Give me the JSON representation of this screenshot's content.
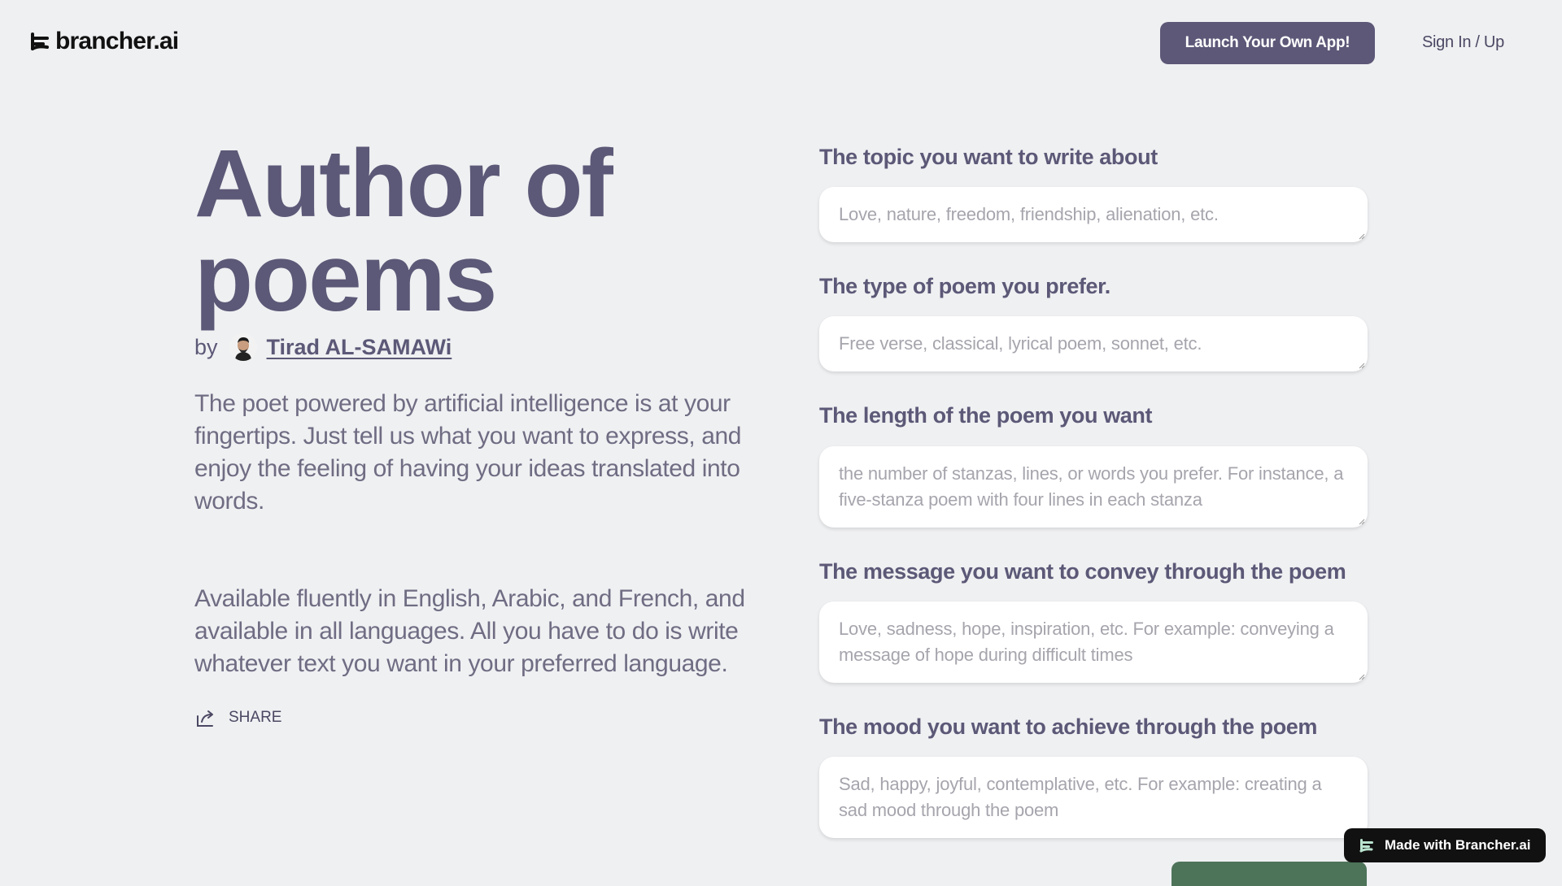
{
  "header": {
    "logo_text": "brancher.ai",
    "launch_button": "Launch Your Own App!",
    "signin_link": "Sign In / Up"
  },
  "intro": {
    "title_line1": "Author of",
    "title_line2": "poems",
    "by_label": "by",
    "author_name": "Tirad AL-SAMAWi",
    "description": "The poet powered by artificial intelligence is at your fingertips. Just tell us what you want to express, and enjoy the feeling of having your ideas translated into words.",
    "description2": "Available fluently in English, Arabic, and French, and available in all languages. All you have to do is write whatever text you want in your preferred language.",
    "share_label": "SHARE"
  },
  "form": {
    "fields": [
      {
        "label": "The topic you want to write about",
        "placeholder": "Love, nature, freedom, friendship, alienation, etc."
      },
      {
        "label": "The type of poem you prefer.",
        "placeholder": "Free verse, classical, lyrical poem, sonnet, etc."
      },
      {
        "label": "The length of the poem you want",
        "placeholder": "the number of stanzas, lines, or words you prefer. For instance, a five-stanza poem with four lines in each stanza"
      },
      {
        "label": "The message you want to convey through the poem",
        "placeholder": "Love, sadness, hope, inspiration, etc. For example: conveying a message of hope during difficult times"
      },
      {
        "label": "The mood you want to achieve through the poem",
        "placeholder": "Sad, happy, joyful, contemplative, etc. For example: creating a sad mood through the poem"
      }
    ]
  },
  "badge": {
    "made_with": "Made with Brancher.ai"
  },
  "colors": {
    "accent": "#5d5878",
    "submit_green": "#4d7359",
    "background": "#eff0f2"
  }
}
